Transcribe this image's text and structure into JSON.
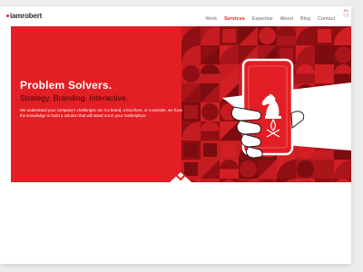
{
  "brand": {
    "name": "iamrobert",
    "accent": "#e31e24",
    "dark": "#9e1214"
  },
  "nav": {
    "items": [
      {
        "label": "Work",
        "active": false
      },
      {
        "label": "Services",
        "active": true
      },
      {
        "label": "Expertise",
        "active": false
      },
      {
        "label": "About",
        "active": false
      },
      {
        "label": "Blog",
        "active": false
      },
      {
        "label": "Contact",
        "active": false
      }
    ]
  },
  "languages": [
    "EN",
    "中文"
  ],
  "hero": {
    "title": "Problem Solvers.",
    "tagline": "Strategy. Branding. Interactive.",
    "body": "We understand your company's challenges. Be it a brand, a brochure, or a website, we have the knowledge to build a solution that will stand out in your marketplace."
  },
  "icons": {
    "logo_mark": "dot-icon",
    "scroll": "chevron-down-icon",
    "illustration": "hand-holding-phone-illustration",
    "chess": "knight-chess-icon",
    "fire": "campfire-icon"
  }
}
